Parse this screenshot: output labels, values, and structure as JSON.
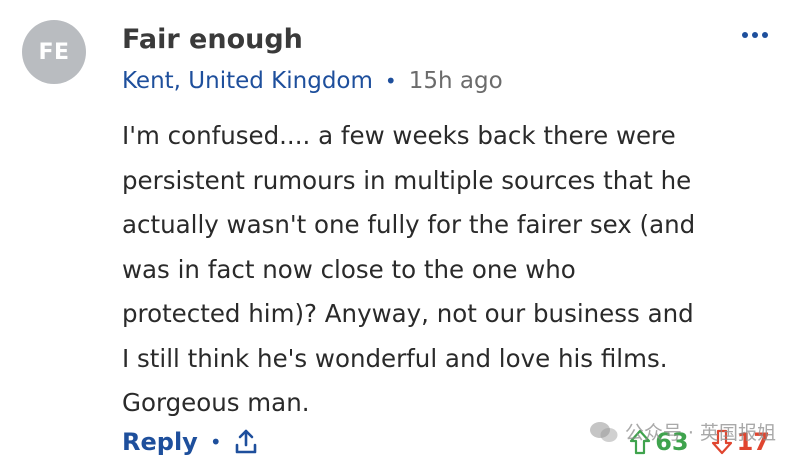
{
  "comment": {
    "avatar_initials": "FE",
    "username": "Fair enough",
    "location": "Kent, United Kingdom",
    "separator": "•",
    "time_ago": "15h ago",
    "body": "I'm confused.... a few weeks back there were\npersistent rumours in multiple sources that he\nactually wasn't one fully for the fairer sex (and\nwas in fact now close to the one who\nprotected him)?  Anyway, not our business and\nI still think he's wonderful and love his films.\nGorgeous man.",
    "reply_label": "Reply",
    "upvotes": "63",
    "downvotes": "17"
  },
  "icons": {
    "more": "more-horizontal-icon",
    "share": "share-icon",
    "upvote": "arrow-up-icon",
    "downvote": "arrow-down-icon"
  },
  "colors": {
    "link_blue": "#1e4f9c",
    "upvote_green": "#3fa34d",
    "downvote_red": "#e0452f",
    "avatar_gray": "#b9bcc0"
  },
  "watermark": {
    "text": "公众号 · 英国报姐"
  }
}
